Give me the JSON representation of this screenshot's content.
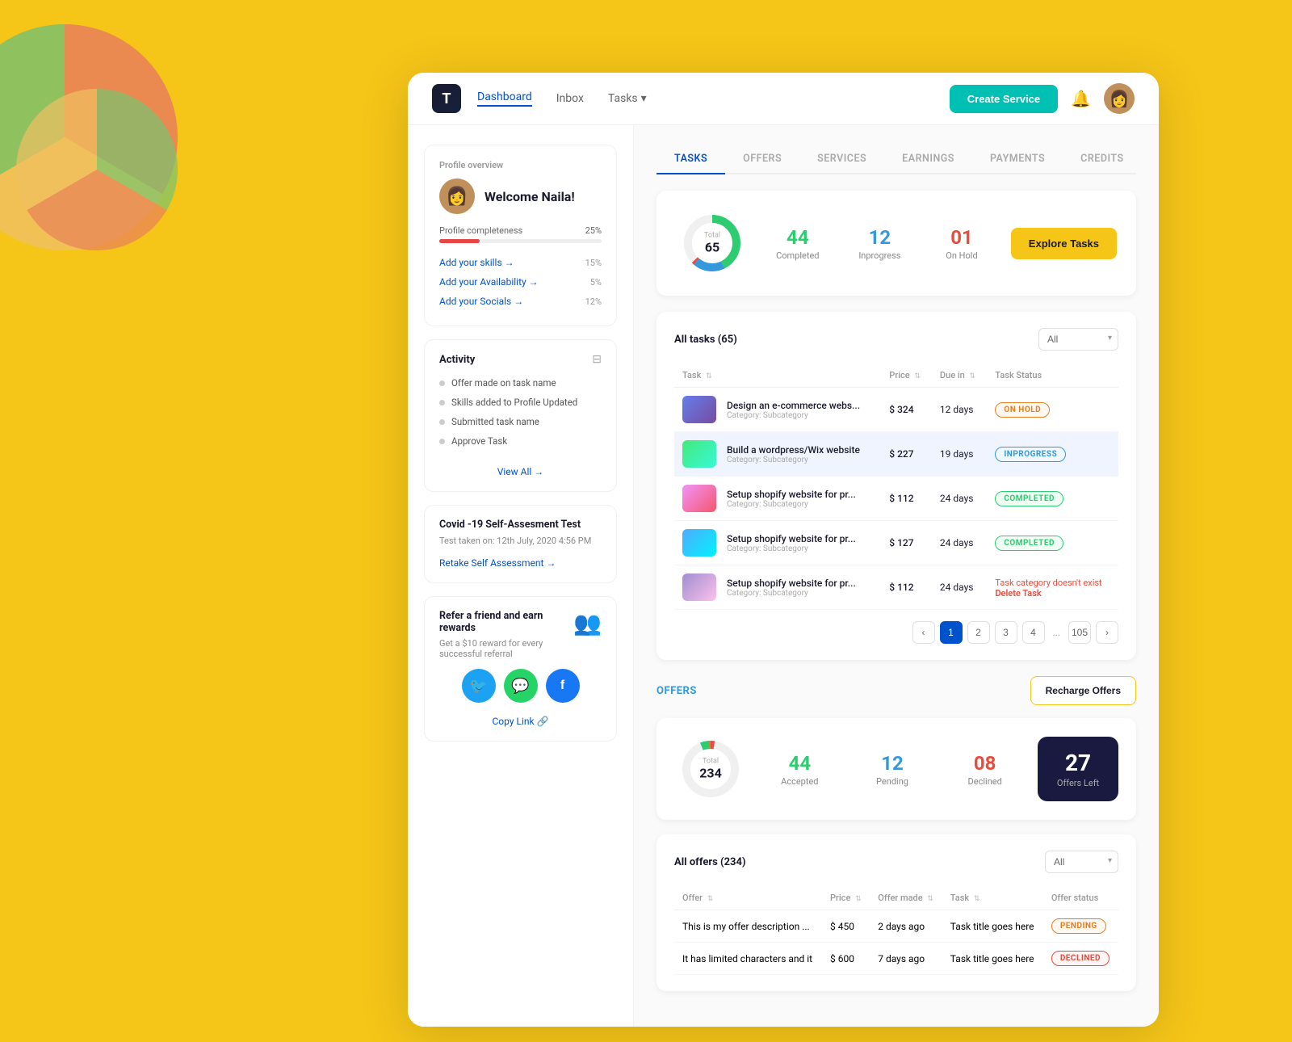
{
  "background": {
    "color": "#F5C518"
  },
  "navbar": {
    "logo_text": "T",
    "nav_items": [
      {
        "label": "Dashboard",
        "active": true
      },
      {
        "label": "Inbox",
        "active": false
      },
      {
        "label": "Tasks",
        "active": false,
        "has_dropdown": true
      }
    ],
    "create_service_label": "Create Service",
    "bell_icon": "🔔"
  },
  "sidebar": {
    "profile_section": {
      "title": "Profile overview",
      "welcome_text": "Welcome Naila!",
      "profile_completeness_label": "Profile completeness",
      "completeness_pct": "25%",
      "progress_fill": "25",
      "items": [
        {
          "label": "Add your skills →",
          "pct": "15%"
        },
        {
          "label": "Add your Availability →",
          "pct": "5%"
        },
        {
          "label": "Add your Socials →",
          "pct": "12%"
        }
      ]
    },
    "activity": {
      "title": "Activity",
      "items": [
        "Offer made on task name",
        "Skills added to Profile Updated",
        "Submitted task name",
        "Approve Task"
      ],
      "view_all_label": "View All →"
    },
    "covid": {
      "title": "Covid -19 Self-Assesment Test",
      "subtitle": "Test taken on: 12th July, 2020 4:56 PM",
      "retake_label": "Retake Self Assessment →"
    },
    "refer": {
      "title": "Refer a friend and earn rewards",
      "subtitle": "Get a $10 reward for every successful referral",
      "social_icons": [
        {
          "name": "twitter",
          "symbol": "🐦",
          "bg": "#1DA1F2"
        },
        {
          "name": "whatsapp",
          "symbol": "💬",
          "bg": "#25D366"
        },
        {
          "name": "facebook",
          "symbol": "f",
          "bg": "#1877F2"
        }
      ],
      "copy_link_label": "Copy Link 🔗"
    }
  },
  "main": {
    "tabs": [
      {
        "label": "TASKS",
        "active": true
      },
      {
        "label": "OFFERS",
        "active": false
      },
      {
        "label": "SERVICES",
        "active": false
      },
      {
        "label": "EARNINGS",
        "active": false
      },
      {
        "label": "PAYMENTS",
        "active": false
      },
      {
        "label": "CREDITS",
        "active": false
      }
    ],
    "tasks": {
      "explore_btn": "Explore Tasks",
      "donut": {
        "total_label": "Total",
        "total": "65",
        "segments": [
          {
            "label": "Completed",
            "value": 44,
            "color": "#2ecc71"
          },
          {
            "label": "Inprogress",
            "value": 12,
            "color": "#3498db"
          },
          {
            "label": "On Hold",
            "value": 1,
            "color": "#e74c3c"
          }
        ]
      },
      "stats": [
        {
          "num": "44",
          "label": "Completed",
          "class": "stat-completed"
        },
        {
          "num": "12",
          "label": "Inprogress",
          "class": "stat-inprogress"
        },
        {
          "num": "01",
          "label": "On Hold",
          "class": "stat-onhold"
        }
      ],
      "all_tasks_title": "All tasks (65)",
      "filter_default": "All",
      "columns": [
        "Task",
        "Price",
        "Due in",
        "Task Status"
      ],
      "rows": [
        {
          "name": "Design an e-commerce webs...",
          "category": "Category: Subcategory",
          "price": "$ 324",
          "due": "12 days",
          "status": "ON HOLD",
          "status_class": "badge-onhold",
          "highlighted": false
        },
        {
          "name": "Build a wordpress/Wix website",
          "category": "Category: Subcategory",
          "price": "$ 227",
          "due": "19 days",
          "status": "INPROGRESS",
          "status_class": "badge-inprogress",
          "highlighted": true
        },
        {
          "name": "Setup shopify website for pr...",
          "category": "Category: Subcategory",
          "price": "$ 112",
          "due": "24 days",
          "status": "COMPLETED",
          "status_class": "badge-completed",
          "highlighted": false
        },
        {
          "name": "Setup shopify website for pr...",
          "category": "Category: Subcategory",
          "price": "$ 127",
          "due": "24 days",
          "status": "COMPLETED",
          "status_class": "badge-completed",
          "highlighted": false
        },
        {
          "name": "Setup shopify website for pr...",
          "category": "Category: Subcategory",
          "price": "$ 112",
          "due": "24 days",
          "status_error": "Task category doesn't exist",
          "status_delete": "Delete Task",
          "status": "",
          "status_class": "",
          "highlighted": false
        }
      ],
      "pagination": {
        "current": 1,
        "pages": [
          "1",
          "2",
          "3",
          "4",
          "...",
          "105"
        ]
      }
    },
    "offers": {
      "title": "OFFERS",
      "recharge_btn": "Recharge Offers",
      "donut": {
        "total_label": "Total",
        "total": "234",
        "segments": [
          {
            "label": "Accepted",
            "value": 44,
            "color": "#2ecc71"
          },
          {
            "label": "Pending",
            "value": 12,
            "color": "#e67e22"
          },
          {
            "label": "Declined",
            "value": 8,
            "color": "#e74c3c"
          }
        ]
      },
      "stats": [
        {
          "num": "44",
          "label": "Accepted",
          "class": "stat-completed"
        },
        {
          "num": "12",
          "label": "Pending",
          "class": "stat-inprogress"
        },
        {
          "num": "08",
          "label": "Declined",
          "class": "stat-onhold"
        }
      ],
      "offers_left": {
        "num": "27",
        "label": "Offers Left"
      },
      "all_offers_title": "All offers (234)",
      "filter_default": "All",
      "columns": [
        "Offer",
        "Price",
        "Offer made",
        "Task",
        "Offer status"
      ],
      "rows": [
        {
          "offer": "This is my offer description ...",
          "price": "$ 450",
          "offer_made": "2 days ago",
          "task": "Task title goes here",
          "status": "PENDING",
          "status_class": "badge-pending"
        },
        {
          "offer": "It has limited characters and it",
          "price": "$ 600",
          "offer_made": "7 days ago",
          "task": "Task title goes here",
          "status": "DECLINED",
          "status_class": "badge-declined"
        }
      ]
    }
  }
}
